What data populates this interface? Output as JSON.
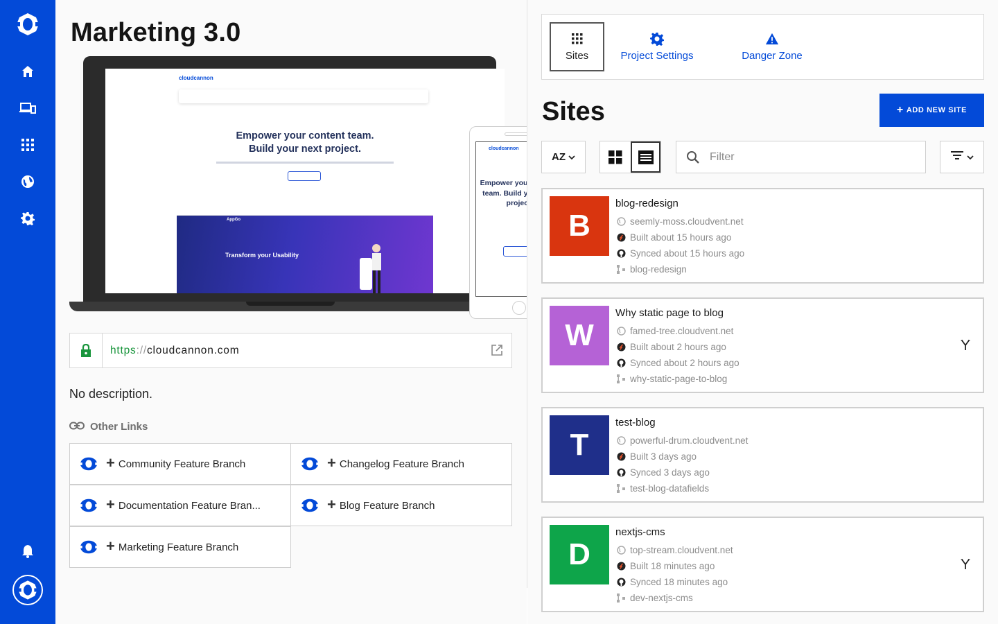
{
  "app": {
    "brand_color": "#034ad8"
  },
  "sidebar": {
    "items": [
      {
        "name": "home-icon"
      },
      {
        "name": "devices-icon"
      },
      {
        "name": "grid-icon"
      },
      {
        "name": "globe-icon"
      },
      {
        "name": "gear-icon"
      }
    ],
    "bottom": [
      {
        "name": "bell-icon"
      },
      {
        "name": "account-avatar"
      }
    ]
  },
  "project": {
    "title": "Marketing 3.0",
    "preview": {
      "laptop_logo": "cloudcannon",
      "laptop_headline_1": "Empower your content team.",
      "laptop_headline_2": "Build your next project.",
      "app_headline": "Transform your Usability",
      "app_brand": "AppGo",
      "phone_logo": "cloudcannon",
      "phone_headline": "Empower your content team. Build your next project."
    },
    "url": {
      "protocol": "https",
      "separator": "://",
      "host": "cloudcannon.com"
    },
    "description": "No description.",
    "other_links_label": "Other Links",
    "links": [
      {
        "label": "Community Feature Branch"
      },
      {
        "label": "Changelog Feature Branch"
      },
      {
        "label": "Documentation Feature Bran..."
      },
      {
        "label": "Blog Feature Branch"
      },
      {
        "label": "Marketing Feature Branch"
      }
    ]
  },
  "tabs": {
    "sites": "Sites",
    "settings": "Project Settings",
    "danger": "Danger Zone"
  },
  "sites_section": {
    "title": "Sites",
    "add_button": "ADD NEW SITE",
    "sort_label": "AZ",
    "filter_placeholder": "Filter",
    "sites": [
      {
        "letter": "B",
        "color": "#d9350f",
        "name": "blog-redesign",
        "domain": "seemly-moss.cloudvent.net",
        "built": "Built about 15 hours ago",
        "synced": "Synced about 15 hours ago",
        "branch": "blog-redesign",
        "has_branch_action": false
      },
      {
        "letter": "W",
        "color": "#b562d6",
        "name": "Why static page to blog",
        "domain": "famed-tree.cloudvent.net",
        "built": "Built about 2 hours ago",
        "synced": "Synced about 2 hours ago",
        "branch": "why-static-page-to-blog",
        "has_branch_action": true
      },
      {
        "letter": "T",
        "color": "#1f2f8a",
        "name": "test-blog",
        "domain": "powerful-drum.cloudvent.net",
        "built": "Built 3 days ago",
        "synced": "Synced 3 days ago",
        "branch": "test-blog-datafields",
        "has_branch_action": false
      },
      {
        "letter": "D",
        "color": "#0ea54a",
        "name": "nextjs-cms",
        "domain": "top-stream.cloudvent.net",
        "built": "Built 18 minutes ago",
        "synced": "Synced 18 minutes ago",
        "branch": "dev-nextjs-cms",
        "has_branch_action": true
      }
    ]
  }
}
